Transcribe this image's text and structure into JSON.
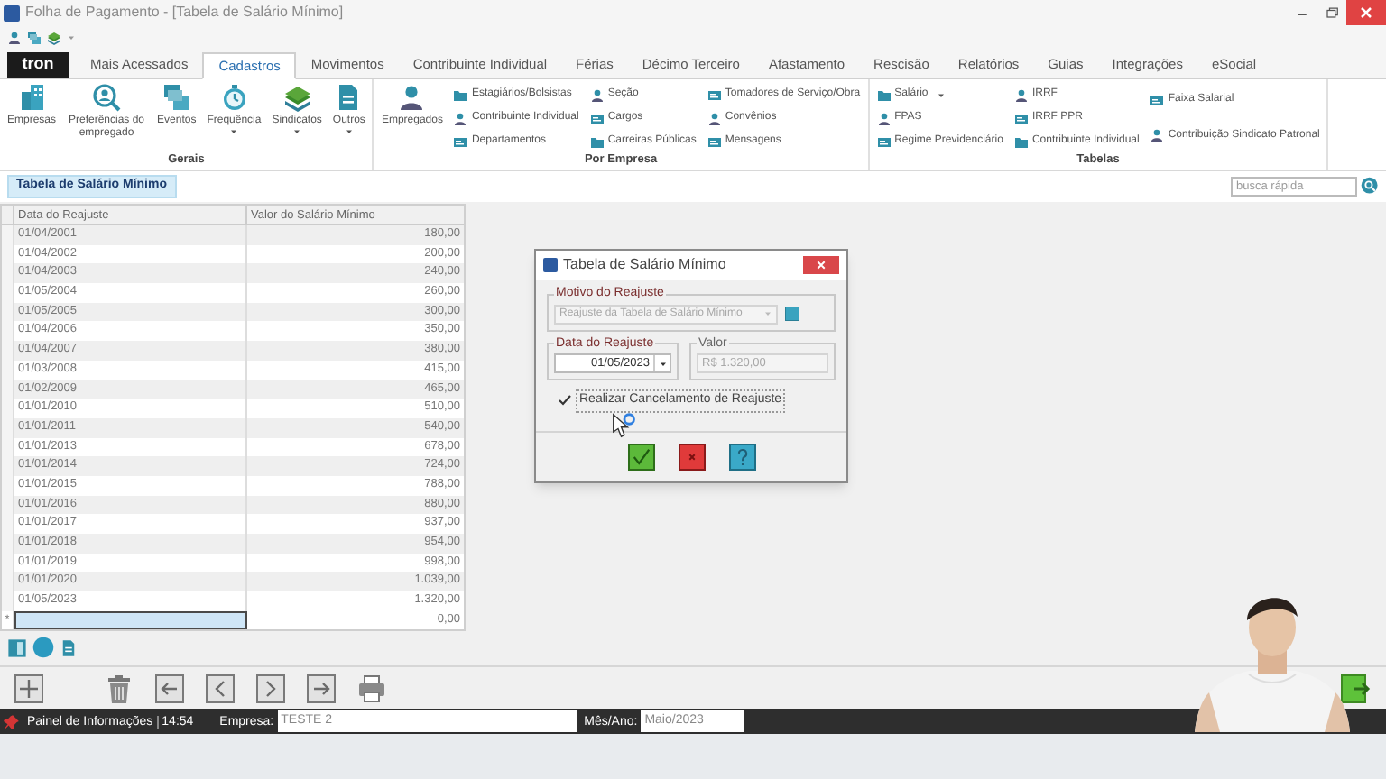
{
  "window": {
    "title": "Folha de Pagamento - [Tabela de Salário Mínimo]"
  },
  "logo": "tron",
  "tabs": [
    {
      "label": "Mais Acessados",
      "selected": false
    },
    {
      "label": "Cadastros",
      "selected": true
    },
    {
      "label": "Movimentos",
      "selected": false
    },
    {
      "label": "Contribuinte Individual",
      "selected": false
    },
    {
      "label": "Férias",
      "selected": false
    },
    {
      "label": "Décimo Terceiro",
      "selected": false
    },
    {
      "label": "Afastamento",
      "selected": false
    },
    {
      "label": "Rescisão",
      "selected": false
    },
    {
      "label": "Relatórios",
      "selected": false
    },
    {
      "label": "Guias",
      "selected": false
    },
    {
      "label": "Integrações",
      "selected": false
    },
    {
      "label": "eSocial",
      "selected": false
    }
  ],
  "ribbon": [
    {
      "title": "Gerais",
      "large": [
        {
          "label": "Empresas",
          "has_menu": false
        },
        {
          "label": "Preferências do empregado",
          "has_menu": false
        },
        {
          "label": "Eventos",
          "has_menu": false
        },
        {
          "label": "Frequência",
          "has_menu": true
        },
        {
          "label": "Sindicatos",
          "has_menu": true
        },
        {
          "label": "Outros",
          "has_menu": true
        }
      ]
    },
    {
      "title": "Por Empresa",
      "large": [
        {
          "label": "Empregados",
          "has_menu": false
        }
      ],
      "columns": [
        [
          {
            "label": "Estagiários/Bolsistas",
            "has_menu": false
          },
          {
            "label": "Contribuinte Individual",
            "has_menu": false
          },
          {
            "label": "Departamentos",
            "has_menu": false
          }
        ],
        [
          {
            "label": "Seção",
            "has_menu": false
          },
          {
            "label": "Cargos",
            "has_menu": false
          },
          {
            "label": "Carreiras Públicas",
            "has_menu": false
          }
        ],
        [
          {
            "label": "Tomadores de Serviço/Obra",
            "has_menu": false
          },
          {
            "label": "Convênios",
            "has_menu": false
          },
          {
            "label": "Mensagens",
            "has_menu": false
          }
        ]
      ]
    },
    {
      "title": "Tabelas",
      "columns": [
        [
          {
            "label": "Salário",
            "has_menu": true
          },
          {
            "label": "FPAS",
            "has_menu": false
          },
          {
            "label": "Regime Previdenciário",
            "has_menu": false
          }
        ],
        [
          {
            "label": "IRRF",
            "has_menu": false
          },
          {
            "label": "IRRF PPR",
            "has_menu": false
          },
          {
            "label": "Contribuinte Individual",
            "has_menu": false
          }
        ],
        [
          {
            "label": "Faixa Salarial",
            "has_menu": false
          },
          {
            "label": "Contribuição Sindicato Patronal",
            "has_menu": false
          }
        ]
      ]
    }
  ],
  "document_tabs": [
    {
      "label": "Tabela de Salário Mínimo",
      "selected": true
    }
  ],
  "search": {
    "placeholder": "busca rápida"
  },
  "table": {
    "columns": [
      "Data do Reajuste",
      "Valor do Salário Mínimo"
    ],
    "rows": [
      [
        "01/04/2001",
        "180,00"
      ],
      [
        "01/04/2002",
        "200,00"
      ],
      [
        "01/04/2003",
        "240,00"
      ],
      [
        "01/05/2004",
        "260,00"
      ],
      [
        "01/05/2005",
        "300,00"
      ],
      [
        "01/04/2006",
        "350,00"
      ],
      [
        "01/04/2007",
        "380,00"
      ],
      [
        "01/03/2008",
        "415,00"
      ],
      [
        "01/02/2009",
        "465,00"
      ],
      [
        "01/01/2010",
        "510,00"
      ],
      [
        "01/01/2011",
        "540,00"
      ],
      [
        "01/01/2013",
        "678,00"
      ],
      [
        "01/01/2014",
        "724,00"
      ],
      [
        "01/01/2015",
        "788,00"
      ],
      [
        "01/01/2016",
        "880,00"
      ],
      [
        "01/01/2017",
        "937,00"
      ],
      [
        "01/01/2018",
        "954,00"
      ],
      [
        "01/01/2019",
        "998,00"
      ],
      [
        "01/01/2020",
        "1.039,00"
      ],
      [
        "01/05/2023",
        "1.320,00"
      ]
    ],
    "new_row": {
      "marker": "*",
      "value": "0,00"
    }
  },
  "dialog": {
    "title": "Tabela de Salário Mínimo",
    "reason": {
      "label": "Motivo do Reajuste",
      "value": "Reajuste da Tabela de Salário Mínimo",
      "disabled": true
    },
    "date": {
      "label": "Data do Reajuste",
      "value": "01/05/2023",
      "disabled": false
    },
    "amount": {
      "label": "Valor",
      "value": "R$ 1.320,00",
      "disabled": true
    },
    "checkbox": {
      "label": "Realizar Cancelamento de Reajuste",
      "checked": true
    }
  },
  "status_bar": {
    "panel": "Painel de Informações",
    "time": "14:54",
    "company_label": "Empresa:",
    "company": "TESTE 2",
    "period_label": "Mês/Ano:",
    "period": "Maio/2023"
  }
}
